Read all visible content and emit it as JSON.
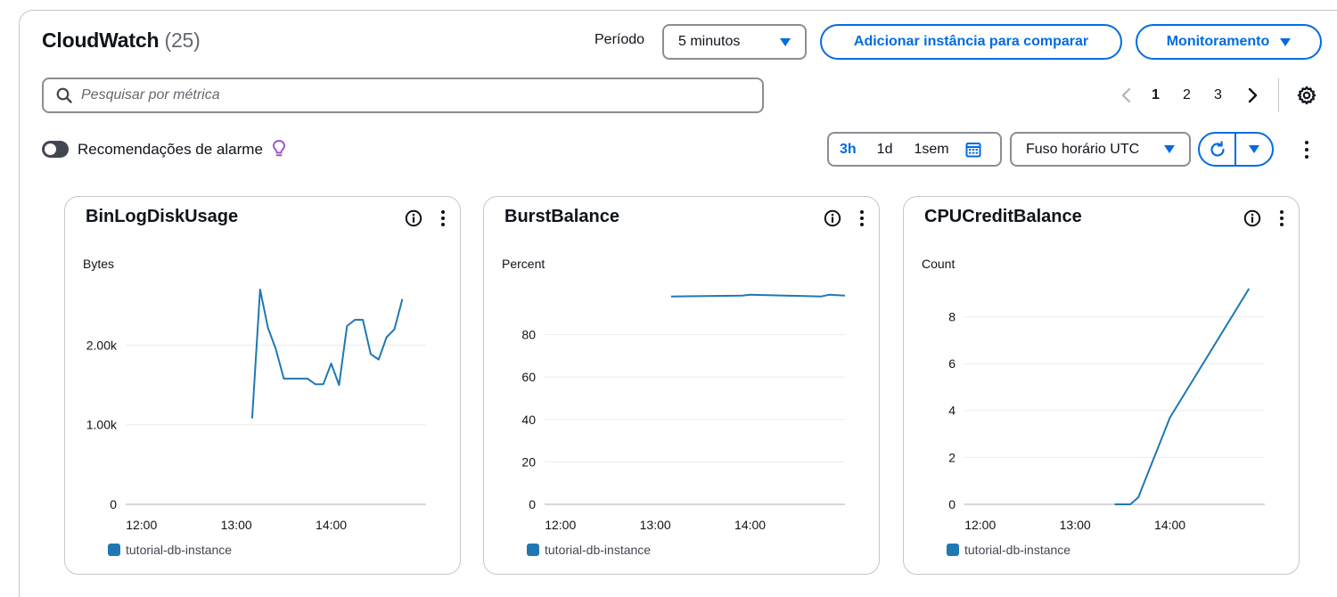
{
  "header": {
    "title": "CloudWatch",
    "count": "(25)",
    "period_label": "Período",
    "period_value": "5 minutos",
    "add_instance_label": "Adicionar instância para comparar",
    "monitoring_label": "Monitoramento"
  },
  "search": {
    "placeholder": "Pesquisar por métrica"
  },
  "pagination": {
    "pages": [
      "1",
      "2",
      "3"
    ],
    "current": "1"
  },
  "alarm_toggle": {
    "label": "Recomendações de alarme",
    "enabled": false
  },
  "time_range": {
    "options": [
      "3h",
      "1d",
      "1sem"
    ],
    "selected": "3h"
  },
  "timezone": {
    "value": "Fuso horário UTC"
  },
  "colors": {
    "accent": "#006ce0",
    "series": "#1f78b4",
    "bulb": "#9b59d0"
  },
  "icons": [
    "search-icon",
    "chevron-left-icon",
    "chevron-right-icon",
    "gear-icon",
    "lightbulb-icon",
    "calendar-icon",
    "refresh-icon",
    "caret-down-icon",
    "more-vertical-icon",
    "info-icon"
  ],
  "chart_data": [
    {
      "type": "line",
      "title": "BinLogDiskUsage",
      "ylabel": "Bytes",
      "ylim": [
        0,
        2800
      ],
      "yticks": [
        0,
        1000,
        2000
      ],
      "ytick_labels": [
        "0",
        "1.00k",
        "2.00k"
      ],
      "xlim": [
        "11:50",
        "15:00"
      ],
      "xticks": [
        "12:00",
        "13:00",
        "14:00"
      ],
      "series": [
        {
          "name": "tutorial-db-instance",
          "x": [
            "13:10",
            "13:15",
            "13:20",
            "13:25",
            "13:30",
            "13:35",
            "13:40",
            "13:45",
            "13:50",
            "13:55",
            "14:00",
            "14:05",
            "14:10",
            "14:15",
            "14:20",
            "14:25",
            "14:30",
            "14:35",
            "14:40",
            "14:45"
          ],
          "values": [
            1080,
            2700,
            2220,
            1950,
            1580,
            1580,
            1580,
            1580,
            1510,
            1510,
            1770,
            1500,
            2240,
            2320,
            2320,
            1890,
            1820,
            2100,
            2200,
            2580
          ]
        }
      ],
      "grid": true,
      "legend": "bottom-left"
    },
    {
      "type": "line",
      "title": "BurstBalance",
      "ylabel": "Percent",
      "ylim": [
        0,
        105
      ],
      "yticks": [
        0,
        20,
        40,
        60,
        80
      ],
      "ytick_labels": [
        "0",
        "20",
        "40",
        "60",
        "80"
      ],
      "xlim": [
        "11:50",
        "15:00"
      ],
      "xticks": [
        "12:00",
        "13:00",
        "14:00"
      ],
      "series": [
        {
          "name": "tutorial-db-instance",
          "x": [
            "13:10",
            "13:55",
            "14:00",
            "14:45",
            "14:50",
            "15:00"
          ],
          "values": [
            98.0,
            98.4,
            98.8,
            98.0,
            98.8,
            98.4
          ]
        }
      ],
      "grid": true,
      "legend": "bottom-left"
    },
    {
      "type": "line",
      "title": "CPUCreditBalance",
      "ylabel": "Count",
      "ylim": [
        0,
        9.5
      ],
      "yticks": [
        0,
        2,
        4,
        6,
        8
      ],
      "ytick_labels": [
        "0",
        "2",
        "4",
        "6",
        "8"
      ],
      "xlim": [
        "11:50",
        "15:00"
      ],
      "xticks": [
        "12:00",
        "13:00",
        "14:00"
      ],
      "series": [
        {
          "name": "tutorial-db-instance",
          "x": [
            "13:25",
            "13:35",
            "13:40",
            "14:00",
            "14:50"
          ],
          "values": [
            0,
            0,
            0.3,
            3.7,
            9.2
          ]
        }
      ],
      "grid": true,
      "legend": "bottom-left"
    }
  ]
}
